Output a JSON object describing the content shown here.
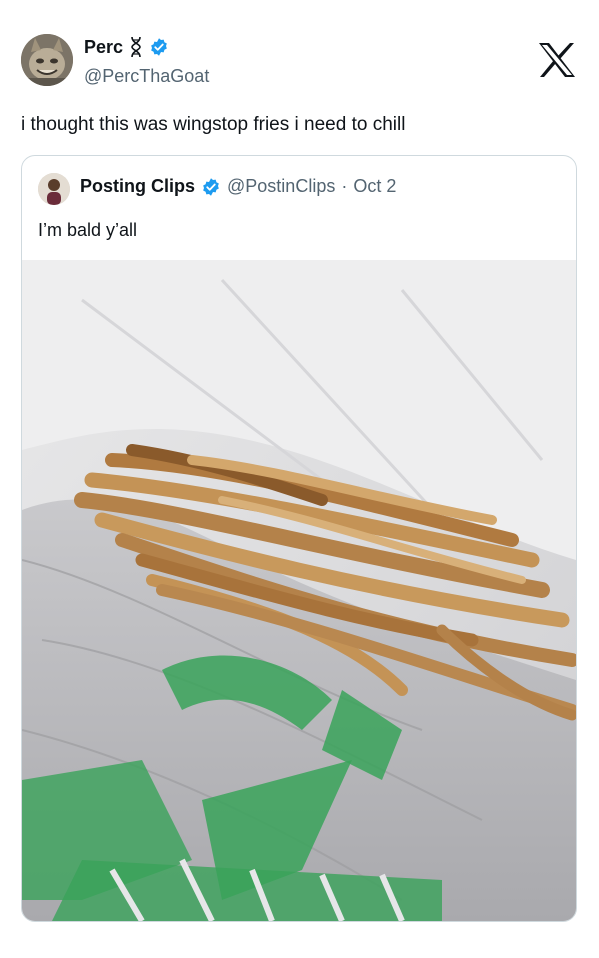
{
  "tweet": {
    "display_name": "Perc",
    "handle": "@PercThaGoat",
    "text": "i thought this was wingstop fries i need to chill"
  },
  "quoted": {
    "display_name": "Posting Clips",
    "handle": "@PostinClips",
    "separator": "·",
    "date": "Oct 2",
    "text": "I’m bald y’all"
  },
  "icons": {
    "verified": "verified-badge-icon",
    "platform": "x-logo-icon",
    "name_emoji": "dna-icon"
  },
  "colors": {
    "verified_blue": "#1d9bf0",
    "secondary_text": "#536471",
    "border": "#cfd9de",
    "bag_green": "#3aa35a"
  }
}
